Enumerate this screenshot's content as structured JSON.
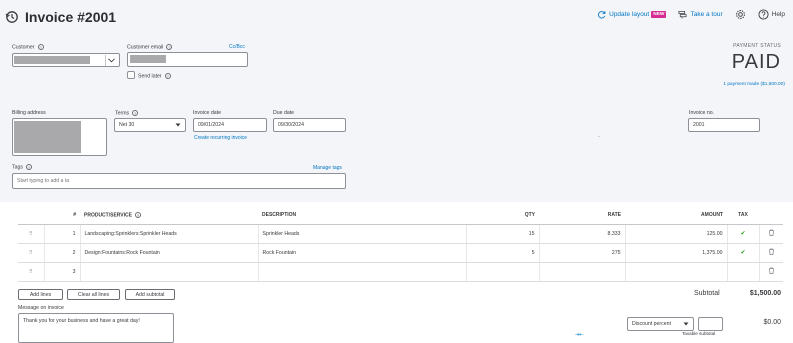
{
  "header": {
    "title": "Invoice #2001",
    "update_layout": "Update layout",
    "new_badge": "NEW",
    "take_tour": "Take a tour",
    "help": "Help"
  },
  "customer": {
    "label": "Customer",
    "email_label": "Customer email",
    "cc_bcc": "Cc/Bcc",
    "send_later": "Send later"
  },
  "status": {
    "label": "PAYMENT STATUS",
    "value": "PAID",
    "payment_link": "1 payment made ($1,500.00)"
  },
  "billing": {
    "label": "Billing address"
  },
  "terms": {
    "label": "Terms",
    "value": "Net 30"
  },
  "invoice_date": {
    "label": "Invoice date",
    "value": "09/01/2024",
    "recurring_link": "Create recurring invoice"
  },
  "due_date": {
    "label": "Due date",
    "value": "09/30/2024"
  },
  "invoice_no": {
    "label": "Invoice no.",
    "value": "2001"
  },
  "tags": {
    "label": "Tags",
    "manage": "Manage tags",
    "placeholder": "Start typing to add a ta"
  },
  "table": {
    "headers": {
      "num": "#",
      "product": "PRODUCT/SERVICE",
      "description": "DESCRIPTION",
      "qty": "QTY",
      "rate": "RATE",
      "amount": "AMOUNT",
      "tax": "TAX"
    },
    "rows": [
      {
        "num": "1",
        "product": "Landscaping:Sprinklers:Sprinkler Heads",
        "description": "Sprinkler Heads",
        "qty": "15",
        "rate": "8.333",
        "amount": "125.00",
        "tax": "✔"
      },
      {
        "num": "2",
        "product": "Design:Fountains:Rock Fountain",
        "description": "Rock Fountain",
        "qty": "5",
        "rate": "275",
        "amount": "1,375.00",
        "tax": "✔"
      },
      {
        "num": "3",
        "product": "",
        "description": "",
        "qty": "",
        "rate": "",
        "amount": "",
        "tax": ""
      }
    ]
  },
  "buttons": {
    "add_lines": "Add lines",
    "clear_lines": "Clear all lines",
    "add_subtotal": "Add subtotal"
  },
  "totals": {
    "subtotal_label": "Subtotal",
    "subtotal_value": "$1,500.00",
    "discount_type": "Discount percent",
    "taxable_subtotal": "Taxable subtotal",
    "discount_value": "$0.00"
  },
  "message": {
    "label": "Message on invoice",
    "value": "Thank you for your business and have a great day!"
  },
  "misc": {
    "dot": "·",
    "arrows": "⇥⇤"
  }
}
